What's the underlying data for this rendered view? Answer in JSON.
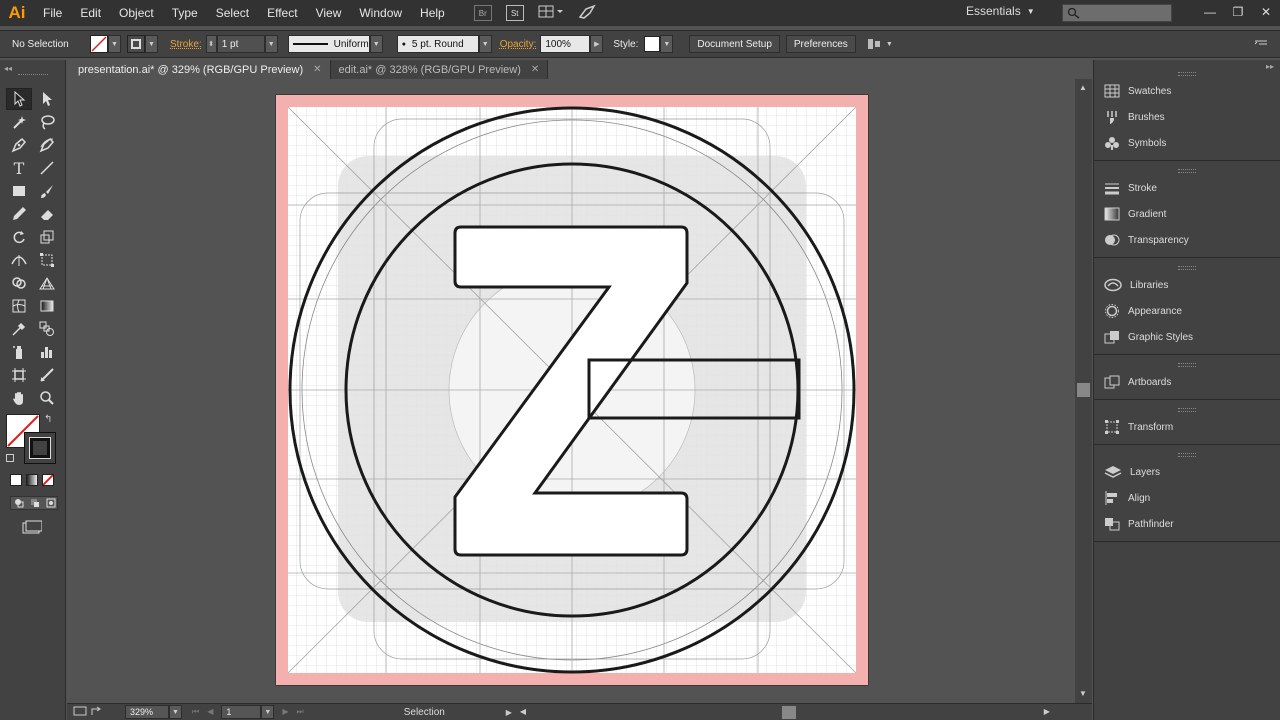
{
  "app": {
    "logo": "Ai"
  },
  "menu": {
    "items": [
      "File",
      "Edit",
      "Object",
      "Type",
      "Select",
      "Effect",
      "View",
      "Window",
      "Help"
    ]
  },
  "menu_icons": {
    "br": "Br",
    "st": "St"
  },
  "workspace": {
    "label": "Essentials"
  },
  "control": {
    "selection": "No Selection",
    "stroke_label": "Stroke:",
    "stroke_weight": "1 pt",
    "profile": "Uniform",
    "brush": "5 pt. Round",
    "opacity_label": "Opacity:",
    "opacity_value": "100%",
    "style_label": "Style:",
    "document_setup": "Document Setup",
    "preferences": "Preferences"
  },
  "tabs": [
    {
      "label": "presentation.ai* @ 329% (RGB/GPU Preview)"
    },
    {
      "label": "edit.ai* @ 328% (RGB/GPU Preview)"
    }
  ],
  "statusbar": {
    "zoom": "329%",
    "artboard": "1",
    "tool": "Selection"
  },
  "panels": {
    "groups": [
      [
        "Swatches",
        "Brushes",
        "Symbols"
      ],
      [
        "Stroke",
        "Gradient",
        "Transparency"
      ],
      [
        "Libraries",
        "Appearance",
        "Graphic Styles"
      ],
      [
        "Artboards"
      ],
      [
        "Transform"
      ],
      [
        "Layers",
        "Align",
        "Pathfinder"
      ]
    ]
  },
  "colors": {
    "accent": "#FF9A00",
    "bleed": "#F4B0AE",
    "artboard": "#FFFFFF"
  }
}
